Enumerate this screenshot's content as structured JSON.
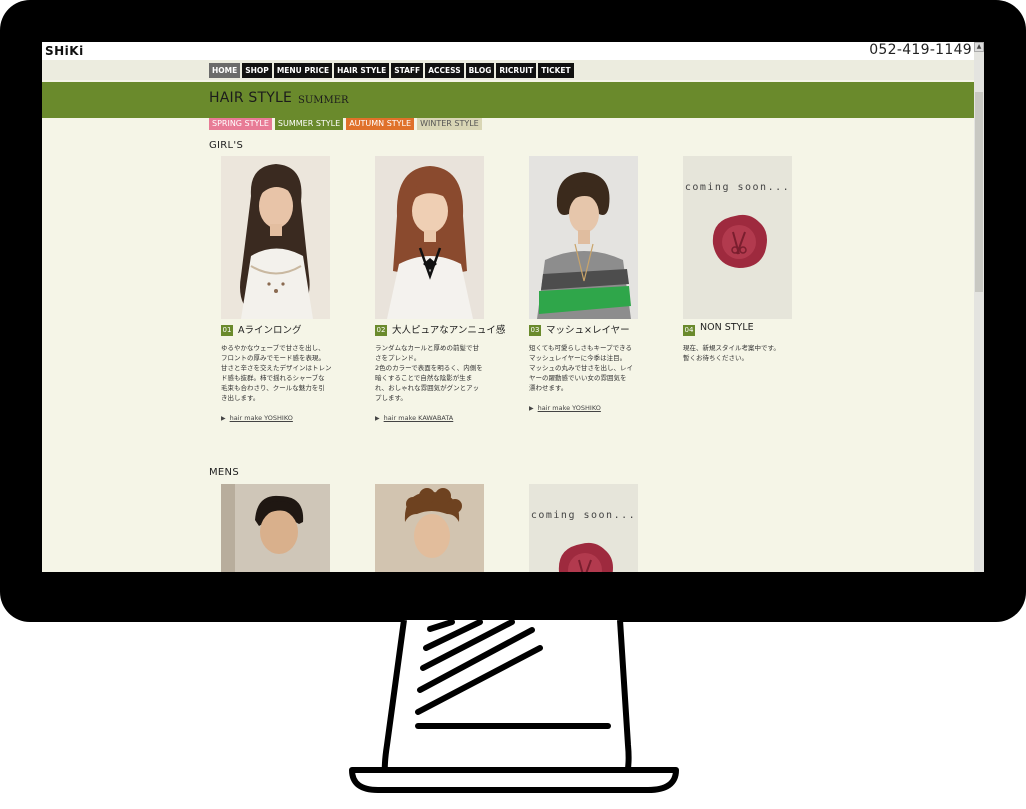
{
  "header": {
    "logo": "SHiKi",
    "phone": "052-419-1149"
  },
  "nav": {
    "items": [
      {
        "label": "HOME",
        "active": true
      },
      {
        "label": "SHOP"
      },
      {
        "label": "MENU PRICE"
      },
      {
        "label": "HAIR STYLE"
      },
      {
        "label": "STAFF"
      },
      {
        "label": "ACCESS"
      },
      {
        "label": "BLOG"
      },
      {
        "label": "RICRUIT"
      },
      {
        "label": "TICKET"
      }
    ]
  },
  "page": {
    "title": "HAIR STYLE",
    "subtitle": "SUMMER"
  },
  "season_tabs": [
    {
      "label": "SPRING STYLE",
      "color": "#e87b96"
    },
    {
      "label": "SUMMER STYLE",
      "color": "#6a8a2c"
    },
    {
      "label": "AUTUMN STYLE",
      "color": "#e0712a"
    },
    {
      "label": "WINTER STYLE",
      "color": "#d9d6b5"
    }
  ],
  "girls": {
    "heading": "GIRL'S",
    "cards": [
      {
        "num": "01",
        "title": "Aラインロング",
        "desc": [
          "ゆるやかなウェーブで甘さを出し、",
          "フロントの厚みでモード感を表現。",
          "甘さと辛さを交えたデザインはトレン",
          "ド感も抜群。柿で揺れるシャーブな",
          "毛束も合わさり、クールな魅力を引",
          "き出します。"
        ],
        "link": "hair make YOSHIKO"
      },
      {
        "num": "02",
        "title": "大人ピュアなアンニュイ感",
        "desc": [
          "ランダムなカールと厚めの前髪で甘",
          "さをプレンド。",
          "2色のカラーで表面を明るく、内側を",
          "暗くすることで自然な陰影が生ま",
          "れ、おしゃれな雰囲気がグンとアッ",
          "プします。"
        ],
        "link": "hair make KAWABATA"
      },
      {
        "num": "03",
        "title": "マッシュ×レイヤー",
        "desc": [
          "短くても可愛らしさもキープできる",
          "マッシュレイヤーに今季は注目。",
          "マッシュの丸みで甘さを出し、レイ",
          "ヤーの躍動感でいい女の雰囲気を",
          "漂わせます。"
        ],
        "link": "hair make YOSHIKO"
      },
      {
        "num": "04",
        "title": "NON STYLE",
        "desc": [
          "現在、新規スタイル考案中です。",
          "暫くお待ちください。"
        ],
        "coming_soon": "coming soon..."
      }
    ]
  },
  "mens": {
    "heading": "MENS",
    "coming_soon": "coming soon..."
  }
}
